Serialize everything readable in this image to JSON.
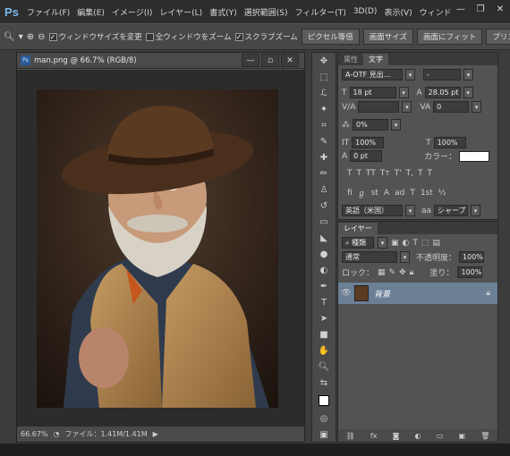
{
  "app": {
    "logo": "Ps"
  },
  "menubar": {
    "items": [
      "ファイル(F)",
      "編集(E)",
      "イメージ(I)",
      "レイヤー(L)",
      "書式(Y)",
      "選択範囲(S)",
      "フィルター(T)",
      "3D(D)",
      "表示(V)",
      "ウィンド"
    ],
    "window_controls": [
      "minimize-icon",
      "restore-icon",
      "close-icon"
    ]
  },
  "options": {
    "resize_windows": "ウィンドウサイズを変更",
    "all_windows": "全ウィンドウをズーム",
    "scrubby_zoom": "スクラブズーム",
    "pixel_ratio": "ピクセル等倍",
    "fit_screen": "画面サイズ",
    "fill_screen": "画面にフィット",
    "print_size": "プリント"
  },
  "document": {
    "title": "man.png @ 66.7% (RGB/8)",
    "icon_label": "Ps",
    "zoom": "66.67%",
    "file_info": "ファイル：1.41M/1.41M"
  },
  "character_panel": {
    "tabs": [
      "属性",
      "文字"
    ],
    "font_family": "A-OTF 見出...",
    "font_style": "-",
    "font_size": "18 pt",
    "leading": "28.05 pt",
    "kerning": "",
    "tracking": "0",
    "tsume": "0%",
    "vert_scale": "100%",
    "horiz_scale": "100%",
    "baseline": "0 pt",
    "color_label": "カラー：",
    "language": "英語（米国）",
    "antialias_label": "aa",
    "antialias": "シャープ",
    "style_buttons": [
      "T",
      "T",
      "TT",
      "Tт",
      "T'",
      "T,",
      "T",
      "T"
    ],
    "opentype_buttons": [
      "fi",
      "ℊ",
      "st",
      "A",
      "ad",
      "T",
      "1st",
      "½"
    ]
  },
  "layers_panel": {
    "tab": "レイヤー",
    "filter_label": "種類",
    "blend_mode": "通常",
    "opacity_label": "不透明度：",
    "opacity": "100%",
    "lock_label": "ロック：",
    "fill_label": "塗り：",
    "fill": "100%",
    "layer_name": "背景"
  },
  "colors": {
    "accent": "#6b7f95",
    "logo": "#7ab8ef",
    "selection": "#6b7f95"
  }
}
